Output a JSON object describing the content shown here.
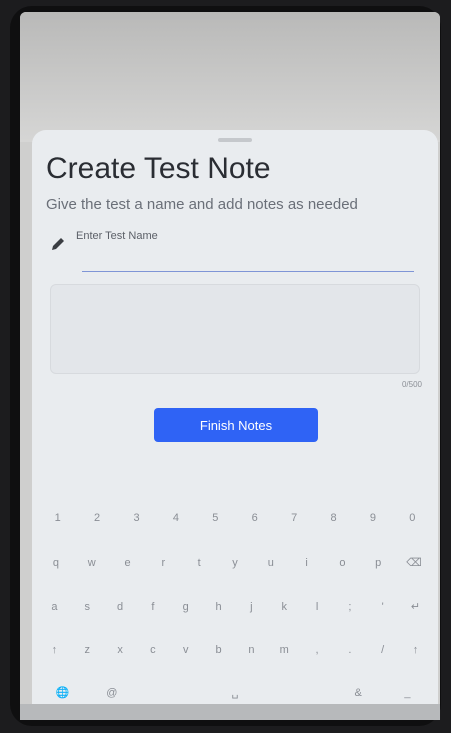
{
  "sheet": {
    "title": "Create Test Note",
    "subtitle": "Give the test a name and add notes as needed",
    "name_label": "Enter Test Name",
    "name_value": "",
    "notes_value": "",
    "counter": "0/500",
    "finish_label": "Finish Notes"
  },
  "keyboard": {
    "row_numbers": [
      "1",
      "2",
      "3",
      "4",
      "5",
      "6",
      "7",
      "8",
      "9",
      "0"
    ],
    "row_top": [
      "q",
      "w",
      "e",
      "r",
      "t",
      "y",
      "u",
      "i",
      "o",
      "p",
      "⌫"
    ],
    "row_middle": [
      "a",
      "s",
      "d",
      "f",
      "g",
      "h",
      "j",
      "k",
      "l",
      ";",
      "'",
      "↵"
    ],
    "row_bottom": [
      "↑",
      "z",
      "x",
      "c",
      "v",
      "b",
      "n",
      "m",
      ",",
      ".",
      "/",
      "↑"
    ],
    "row_space": [
      "🌐",
      "@",
      "␣",
      "&",
      "_"
    ]
  },
  "colors": {
    "accent": "#2f63f5",
    "sheet_bg": "#e9ecef",
    "underline": "#7f95d6"
  }
}
